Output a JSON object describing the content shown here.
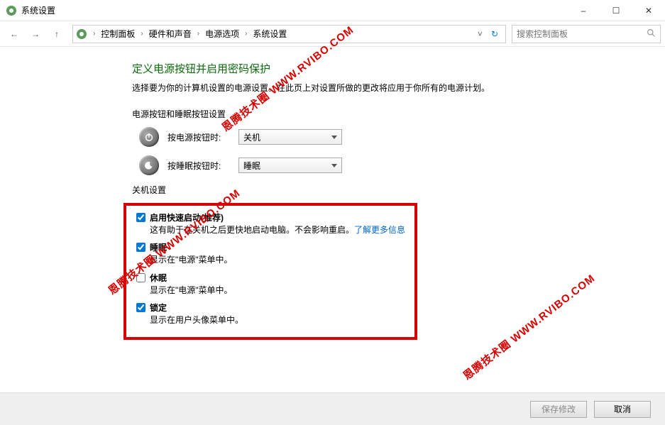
{
  "window": {
    "title": "系统设置"
  },
  "title_controls": {
    "min": "–",
    "max": "☐",
    "close": "✕"
  },
  "nav": {
    "back": "←",
    "fwd": "→",
    "up": "↑",
    "drop": "˅",
    "refresh": "↻"
  },
  "breadcrumb": {
    "items": [
      "控制面板",
      "硬件和声音",
      "电源选项",
      "系统设置"
    ]
  },
  "search": {
    "placeholder": "搜索控制面板"
  },
  "main": {
    "heading": "定义电源按钮并启用密码保护",
    "subtext": "选择要为你的计算机设置的电源设置。在此页上对设置所做的更改将应用于你所有的电源计划。",
    "section_label": "电源按钮和睡眠按钮设置",
    "rows": [
      {
        "label": "按电源按钮时:",
        "value": "关机",
        "icon": "power-icon"
      },
      {
        "label": "按睡眠按钮时:",
        "value": "睡眠",
        "icon": "sleep-icon"
      }
    ],
    "shutdown_label": "关机设置",
    "checks": [
      {
        "title": "启用快速启动(推荐)",
        "checked": true,
        "desc_prefix": "这有助于在关机之后更快地启动电脑。不会影响重启。",
        "link": "了解更多信息"
      },
      {
        "title": "睡眠",
        "checked": true,
        "desc": "显示在\"电源\"菜单中。"
      },
      {
        "title": "休眠",
        "checked": false,
        "desc": "显示在\"电源\"菜单中。"
      },
      {
        "title": "锁定",
        "checked": true,
        "desc": "显示在用户头像菜单中。"
      }
    ]
  },
  "footer": {
    "save": "保存修改",
    "cancel": "取消"
  },
  "watermark": "恩腾技术圈 WWW.RVIBO.COM"
}
